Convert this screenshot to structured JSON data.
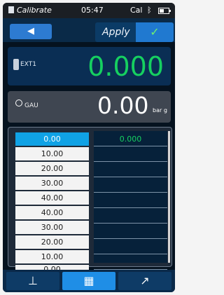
{
  "status_bar": {
    "title": "Calibrate",
    "time": "05:47",
    "mode": "Cal",
    "bluetooth_icon": "bluetooth-icon",
    "battery_icon": "battery-icon"
  },
  "nav": {
    "back_symbol": "◀",
    "apply_label": "Apply",
    "check_symbol": "✓"
  },
  "ext_panel": {
    "channel": "EXT1",
    "value": "0.000",
    "accent": "#16d060"
  },
  "gau_panel": {
    "channel": "GAU",
    "value": "0.00",
    "unit": "bar g"
  },
  "table": {
    "setpoints": [
      "0.00",
      "10.00",
      "20.00",
      "30.00",
      "40.00",
      "40.00",
      "30.00",
      "20.00",
      "10.00",
      "0.00"
    ],
    "readings": [
      "0.000",
      "",
      "",
      "",
      "",
      "",
      "",
      "",
      ""
    ],
    "selected_index": 0
  },
  "tabbar": {
    "tabs": [
      {
        "name": "tab-calibrate",
        "icon": "pressure-icon",
        "symbol": "⊥"
      },
      {
        "name": "tab-table",
        "icon": "table-icon",
        "symbol": "▦"
      },
      {
        "name": "tab-chart",
        "icon": "chart-icon",
        "symbol": "↗"
      }
    ],
    "active": 1
  }
}
